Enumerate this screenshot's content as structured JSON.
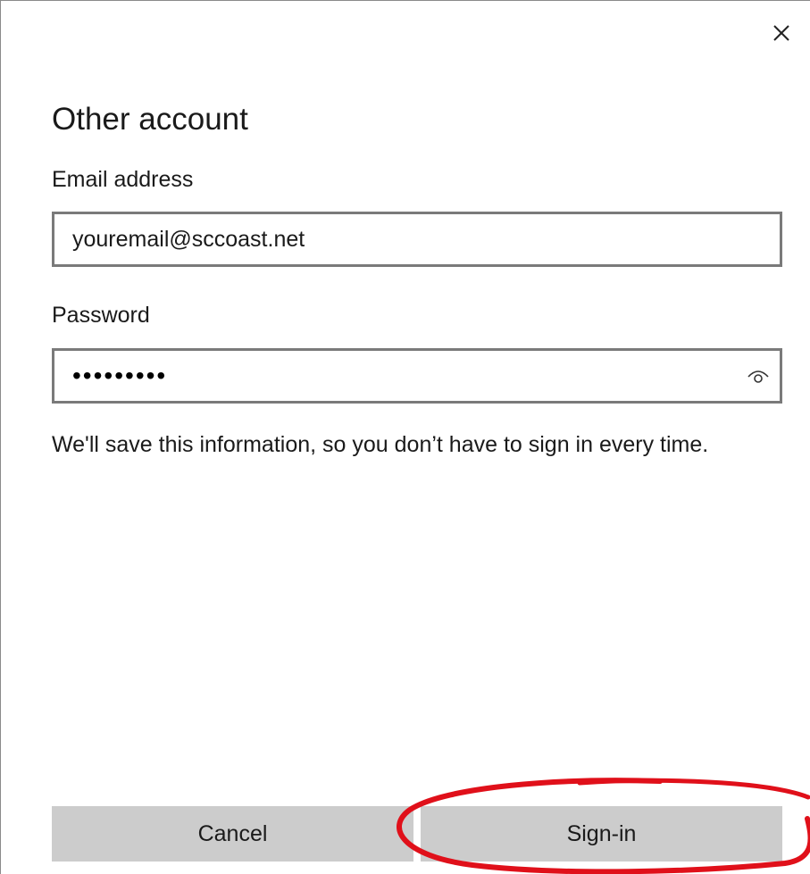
{
  "dialog": {
    "title": "Other account",
    "close_icon": "close-icon"
  },
  "email": {
    "label": "Email address",
    "value": "youremail@sccoast.net"
  },
  "password": {
    "label": "Password",
    "masked_value": "•••••••••",
    "reveal_icon": "eye-icon"
  },
  "info_text": "We'll save this information, so you don’t have to sign in every time.",
  "buttons": {
    "cancel_label": "Cancel",
    "signin_label": "Sign-in"
  },
  "colors": {
    "field_border": "#7a7a7a",
    "button_bg": "#cccccc",
    "annotation": "#e0101a"
  }
}
